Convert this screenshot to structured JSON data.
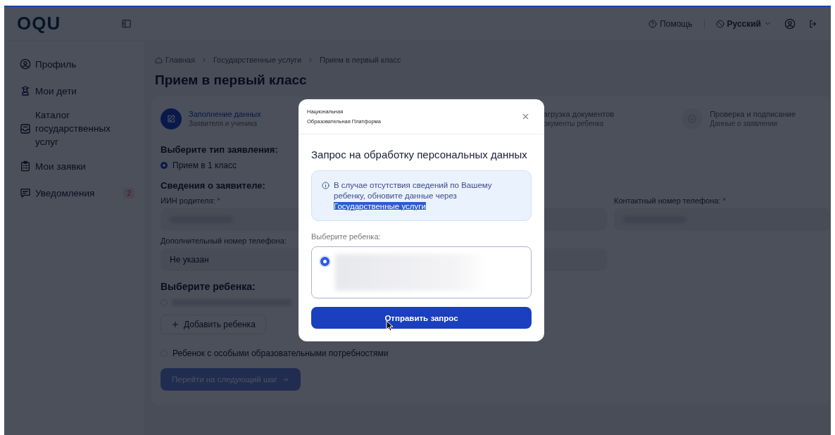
{
  "logo": "OQU",
  "header": {
    "help": "Помощь",
    "language": "Русский"
  },
  "sidebar": {
    "items": [
      {
        "label": "Профиль"
      },
      {
        "label": "Мои дети"
      },
      {
        "label": "Каталог государственных услуг"
      },
      {
        "label": "Мои заявки"
      },
      {
        "label": "Уведомления",
        "badge": "2"
      }
    ]
  },
  "breadcrumbs": [
    "Главная",
    "Государственные услуги",
    "Прием в первый класс"
  ],
  "title": "Прием в первый класс",
  "steps": [
    {
      "title": "Заполнение данных",
      "subtitle": "Заявителя и ученика",
      "active": true
    },
    {
      "title": "агрузка документов",
      "subtitle": "окументы ребенка",
      "active": false
    },
    {
      "title": "Проверка и подписание",
      "subtitle": "Данные о заявлении",
      "active": false
    }
  ],
  "form": {
    "type_heading": "Выберите тип заявления:",
    "types": [
      {
        "label": "Прием в 1 класс",
        "selected": true
      }
    ],
    "applicant_heading": "Сведения о заявителе:",
    "fields": [
      {
        "label": "ИИН родителя:",
        "required_mark": "*"
      },
      {
        "label": "Контактный номер телефона:",
        "required_mark": "*"
      },
      {
        "label": "Дополнительный номер телефона:",
        "value": "Не указан"
      }
    ],
    "child_heading": "Выберите ребенка:",
    "children": [
      {
        "selected": false
      }
    ],
    "add_child": "Добавить ребенка",
    "special_needs": {
      "label": "Ребенок с особыми образовательными потребностями",
      "checked": false
    },
    "next": {
      "label": "Перейти на следующий шаг",
      "disabled": true
    }
  },
  "modal": {
    "org_line1": "Национальная",
    "org_line2": "Образовательная Платформа",
    "title": "Запрос на обработку персональных данных",
    "info_text": "В случае отсутствия сведений по Вашему ребенку, обновите данные через",
    "info_link": "Государственные услуги",
    "child_label": "Выберите ребенка:",
    "child_options": [
      {
        "selected": true
      }
    ],
    "submit": "Отправить запрос"
  }
}
